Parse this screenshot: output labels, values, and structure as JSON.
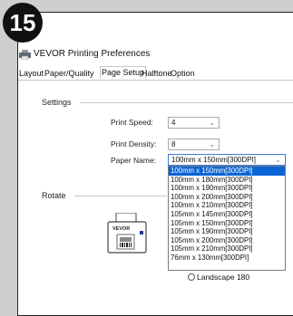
{
  "step_badge": "15",
  "window": {
    "title": "VEVOR Printing Preferences",
    "tabs": [
      "Layout",
      "Paper/Quality",
      "Page Setup",
      "Halftone",
      "Option"
    ],
    "active_tab": "Page Setup"
  },
  "settings": {
    "section_label": "Settings",
    "print_speed_label": "Print Speed:",
    "print_speed_value": "4",
    "print_density_label": "Print Density:",
    "print_density_value": "8",
    "paper_name_label": "Paper Name:",
    "paper_name_value": "100mm x 150mm[300DPI]"
  },
  "paper_options": [
    "100mm x 150mm[300DPI]",
    "100mm x 180mm[300DPI]",
    "100mm x 190mm[300DPI]",
    "100mm x 200mm[300DPI]",
    "100mm x 210mm[300DPI]",
    "105mm x 145mm[300DPI]",
    "105mm x 150mm[300DPI]",
    "105mm x 190mm[300DPI]",
    "105mm x 200mm[300DPI]",
    "105mm x 210mm[300DPI]",
    "76mm x 130mm[300DPI]"
  ],
  "selected_paper_index": 0,
  "rotate": {
    "section_label": "Rotate",
    "printer_brand": "VEVOR",
    "landscape_180_label": "Landscape 180"
  }
}
